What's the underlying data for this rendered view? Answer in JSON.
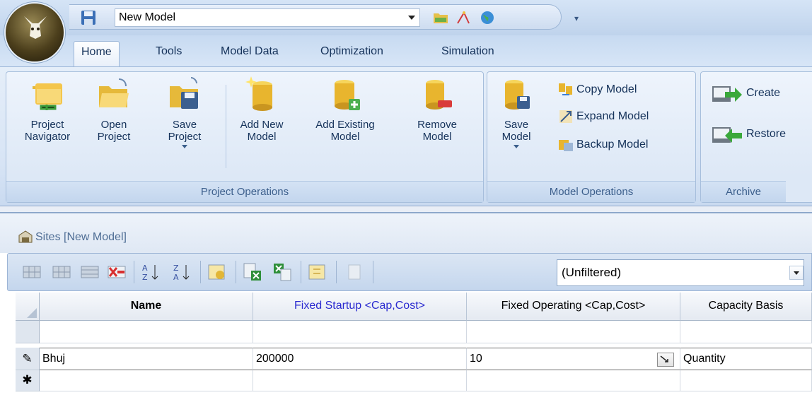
{
  "app": {
    "model_name": "New Model",
    "qat_more": "▾"
  },
  "tabs": [
    "Home",
    "Tools",
    "Model Data",
    "Optimization",
    "Simulation"
  ],
  "ribbon": {
    "project_operations": {
      "label": "Project Operations",
      "buttons": [
        {
          "line1": "Project",
          "line2": "Navigator"
        },
        {
          "line1": "Open",
          "line2": "Project"
        },
        {
          "line1": "Save",
          "line2": "Project"
        },
        {
          "line1": "Add New",
          "line2": "Model"
        },
        {
          "line1": "Add Existing",
          "line2": "Model"
        },
        {
          "line1": "Remove",
          "line2": "Model"
        }
      ]
    },
    "model_operations": {
      "label": "Model Operations",
      "save_line1": "Save",
      "save_line2": "Model",
      "copy": "Copy Model",
      "expand": "Expand Model",
      "backup": "Backup Model"
    },
    "archive": {
      "label": "Archive",
      "create": "Create",
      "restore": "Restore"
    }
  },
  "document": {
    "title": "Sites [New Model]",
    "filter_value": "(Unfiltered)"
  },
  "grid": {
    "columns": [
      "Name",
      "Fixed Startup <Cap,Cost>",
      "Fixed Operating <Cap,Cost>",
      "Capacity Basis"
    ],
    "rows": [
      {
        "marker": "",
        "name": "",
        "fixed_startup": "",
        "fixed_operating": "",
        "capacity_basis": ""
      },
      {
        "marker": "✎",
        "name": "Bhuj",
        "fixed_startup": "200000",
        "fixed_operating": "10",
        "capacity_basis": "Quantity"
      },
      {
        "marker": "✱",
        "name": "",
        "fixed_startup": "",
        "fixed_operating": "",
        "capacity_basis": ""
      }
    ]
  },
  "colors": {
    "accent_blue": "#2a2ad0",
    "ribbon_text": "#15325a",
    "group_label": "#3c5f8c"
  },
  "icons": {
    "orb": "app-orb-icon",
    "save": "floppy-disk-icon"
  }
}
